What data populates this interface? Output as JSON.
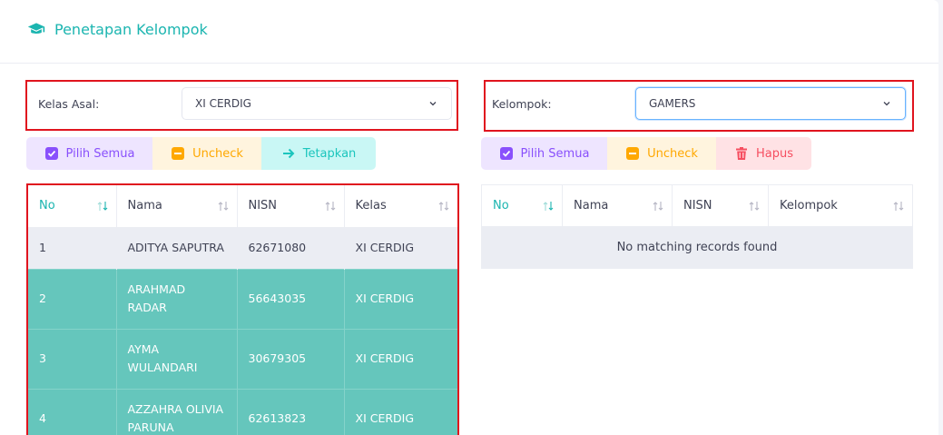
{
  "header": {
    "title": "Penetapan Kelompok",
    "icon": "graduation-cap-icon"
  },
  "left": {
    "class_label": "Kelas Asal:",
    "class_value": "XI CERDIG",
    "buttons": {
      "select_all": "Pilih Semua",
      "uncheck": "Uncheck",
      "assign": "Tetapkan"
    },
    "columns": [
      "No",
      "Nama",
      "NISN",
      "Kelas"
    ],
    "rows": [
      {
        "no": "1",
        "name": "ADITYA SAPUTRA",
        "nisn": "62671080",
        "kelas": "XI CERDIG"
      },
      {
        "no": "2",
        "name": "ARAHMAD RADAR",
        "nisn": "56643035",
        "kelas": "XI CERDIG"
      },
      {
        "no": "3",
        "name": "AYMA WULANDARI",
        "nisn": "30679305",
        "kelas": "XI CERDIG"
      },
      {
        "no": "4",
        "name": "AZZAHRA OLIVIA PARUNA",
        "nisn": "62613823",
        "kelas": "XI CERDIG"
      }
    ]
  },
  "right": {
    "group_label": "Kelompok:",
    "group_value": "GAMERS",
    "buttons": {
      "select_all": "Pilih Semua",
      "uncheck": "Uncheck",
      "delete": "Hapus"
    },
    "columns": [
      "No",
      "Nama",
      "NISN",
      "Kelompok"
    ],
    "empty_message": "No matching records found"
  },
  "colors": {
    "accent": "#1bb5b0",
    "selected_row": "#65c6bc",
    "highlight_border": "#e0141e"
  }
}
